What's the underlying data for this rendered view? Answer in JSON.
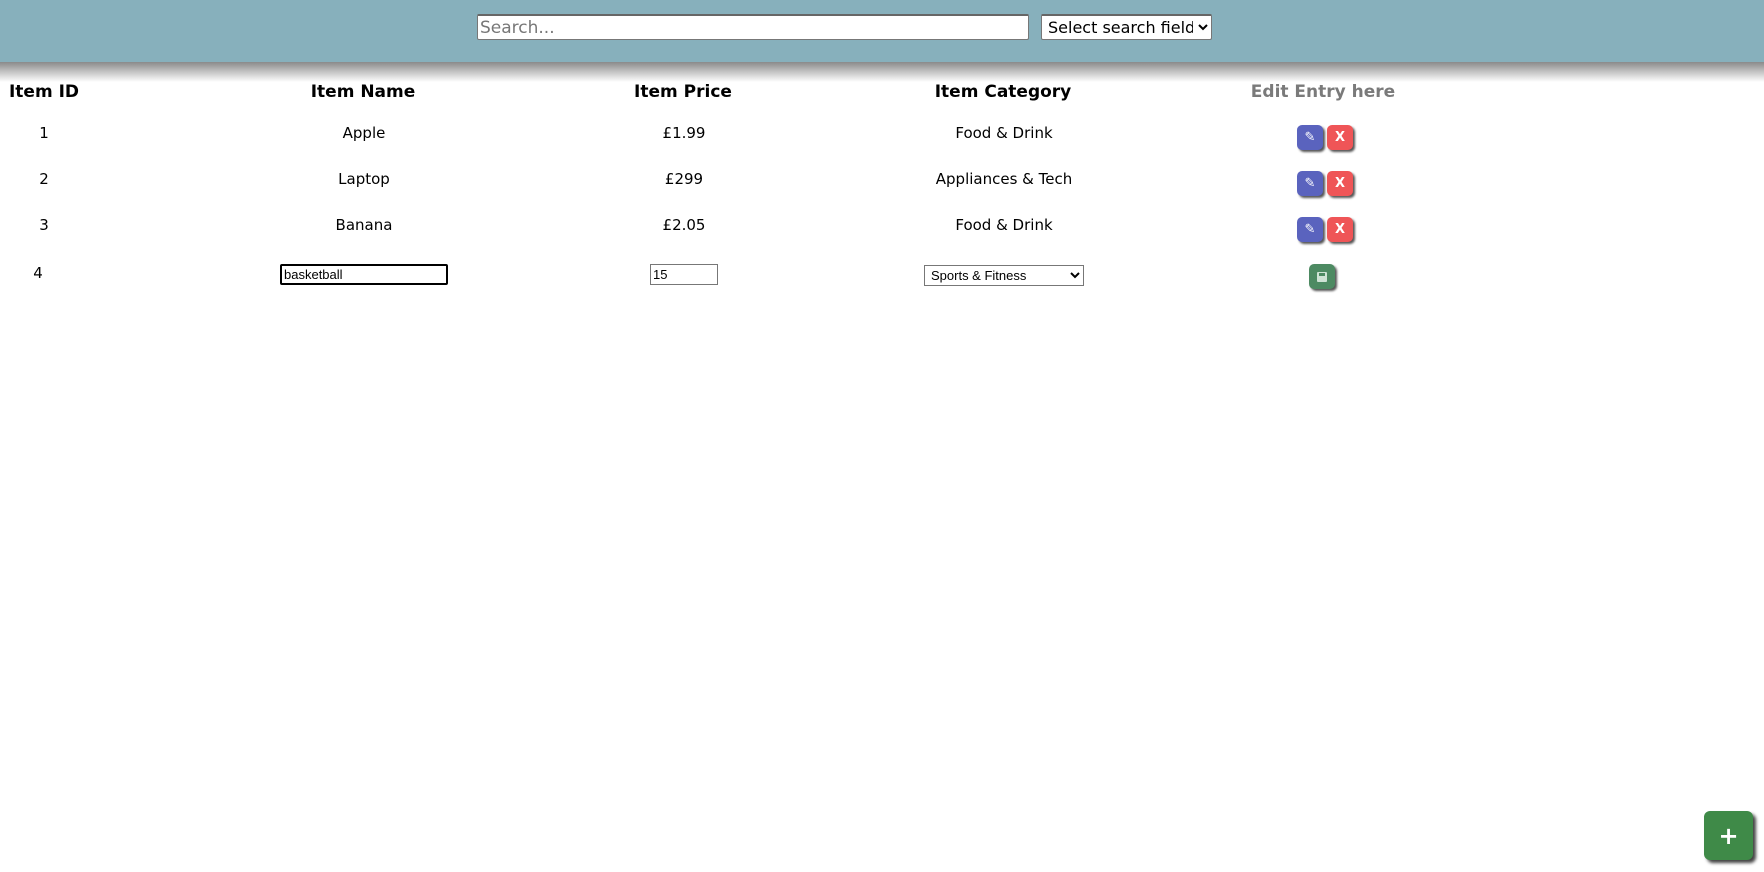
{
  "search": {
    "placeholder": "Search...",
    "field_select": "Select search field"
  },
  "table": {
    "headers": [
      "Item ID",
      "Item Name",
      "Item Price",
      "Item Category",
      "Edit Entry here"
    ],
    "rows": [
      {
        "id": "1",
        "name": "Apple",
        "price": "£1.99",
        "category": "Food & Drink"
      },
      {
        "id": "2",
        "name": "Laptop",
        "price": "£299",
        "category": "Appliances & Tech"
      },
      {
        "id": "3",
        "name": "Banana",
        "price": "£2.05",
        "category": "Food & Drink"
      }
    ],
    "edit_row": {
      "id": "4",
      "name": "basketball",
      "price": "15",
      "category": "Sports & Fitness"
    }
  },
  "buttons": {
    "delete_label": "X",
    "add_label": "+"
  },
  "icons": {
    "edit": "pencil-icon",
    "delete": "x-icon",
    "save": "floppy-disk-icon",
    "add": "plus-icon"
  },
  "colors": {
    "header": "#87b0bc",
    "edit": "#5a63be",
    "delete": "#ef5557",
    "save": "#4d8a62",
    "add": "#3f8a48"
  }
}
